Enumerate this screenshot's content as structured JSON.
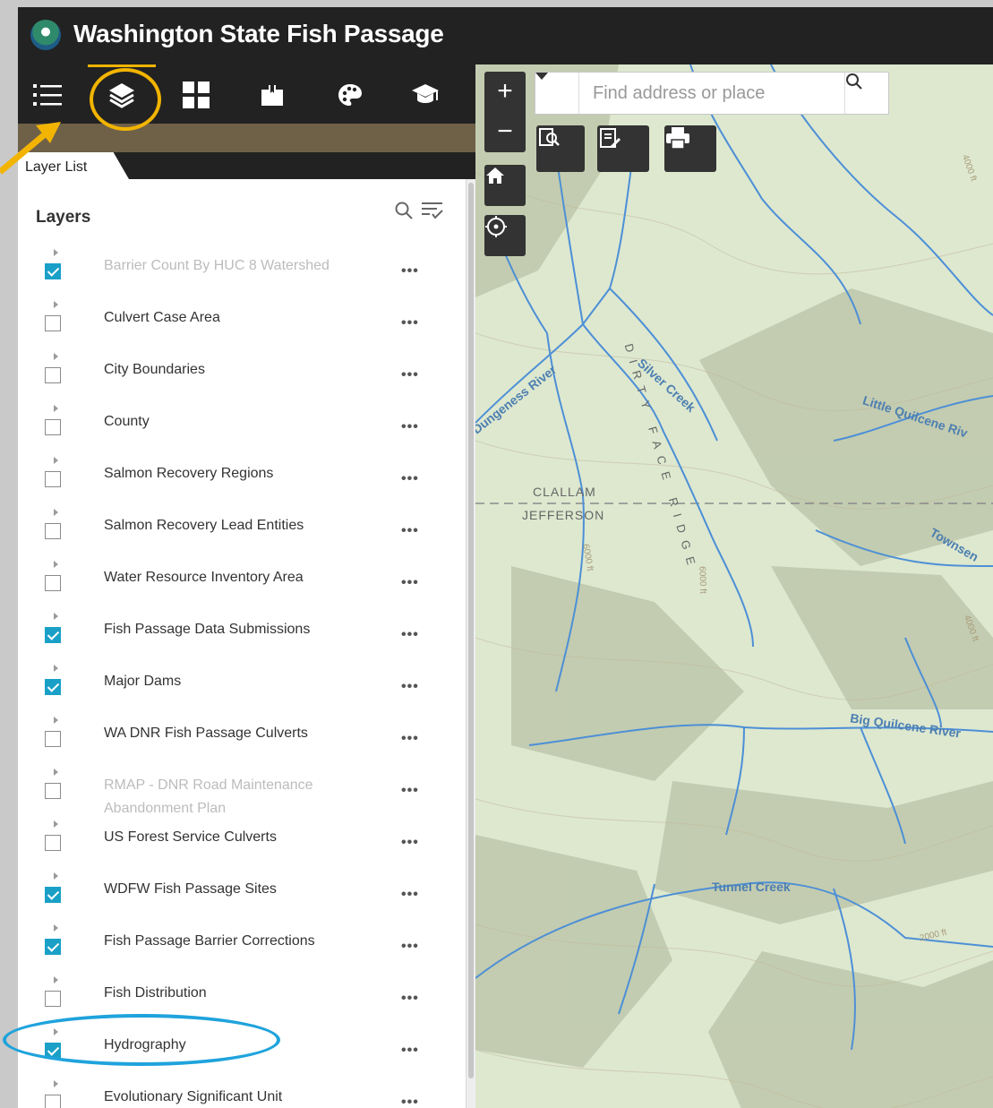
{
  "app": {
    "title": "Washington State Fish Passage"
  },
  "toolbar": {
    "tools": [
      {
        "icon": "list-icon"
      },
      {
        "icon": "layers-icon"
      },
      {
        "icon": "grid-icon"
      },
      {
        "icon": "bookmark-icon"
      },
      {
        "icon": "palette-icon"
      },
      {
        "icon": "graduation-cap-icon"
      }
    ]
  },
  "panel": {
    "tab_label": "Layer List",
    "heading": "Layers",
    "layers": [
      {
        "label": "Barrier Count By HUC 8 Watershed",
        "checked": true,
        "dim": true
      },
      {
        "label": "Culvert Case Area",
        "checked": false,
        "dim": false
      },
      {
        "label": "City Boundaries",
        "checked": false,
        "dim": false
      },
      {
        "label": "County",
        "checked": false,
        "dim": false
      },
      {
        "label": "Salmon Recovery Regions",
        "checked": false,
        "dim": false
      },
      {
        "label": "Salmon Recovery Lead Entities",
        "checked": false,
        "dim": false
      },
      {
        "label": "Water Resource Inventory Area",
        "checked": false,
        "dim": false
      },
      {
        "label": "Fish Passage Data Submissions",
        "checked": true,
        "dim": false
      },
      {
        "label": "Major Dams",
        "checked": true,
        "dim": false
      },
      {
        "label": "WA DNR Fish Passage Culverts",
        "checked": false,
        "dim": false
      },
      {
        "label": "RMAP - DNR Road Maintenance Abandonment Plan",
        "checked": false,
        "dim": true
      },
      {
        "label": "US Forest Service Culverts",
        "checked": false,
        "dim": false
      },
      {
        "label": "WDFW Fish Passage Sites",
        "checked": true,
        "dim": false
      },
      {
        "label": "Fish Passage Barrier Corrections",
        "checked": true,
        "dim": false
      },
      {
        "label": "Fish Distribution",
        "checked": false,
        "dim": false
      },
      {
        "label": "Hydrography",
        "checked": true,
        "dim": false
      },
      {
        "label": "Evolutionary Significant Unit",
        "checked": false,
        "dim": false
      }
    ],
    "more_label": "•••"
  },
  "map": {
    "zoom_in": "+",
    "zoom_out": "−",
    "search_placeholder": "Find address or place",
    "labels": {
      "dungeness": "Dungeness River",
      "silver": "Silver Creek",
      "dirty": "DIRTY FACE RIDGE",
      "little_quilcene": "Little Quilcene Riv",
      "clallam": "CLALLAM",
      "jefferson": "JEFFERSON",
      "townsend": "Townsen",
      "big_quilcene": "Big Quilcene River",
      "tunnel": "Tunnel Creek",
      "elev1": "4000 ft",
      "elev2": "6000 ft",
      "elev3": "2000 ft",
      "elev4": "4000 ft",
      "elev5": "6000 ft"
    }
  },
  "colors": {
    "accent_orange": "#f2b400",
    "checkbox_blue": "#1aa0c7",
    "annotation_blue": "#1fa3dc",
    "river_blue": "#4d8fd6"
  }
}
